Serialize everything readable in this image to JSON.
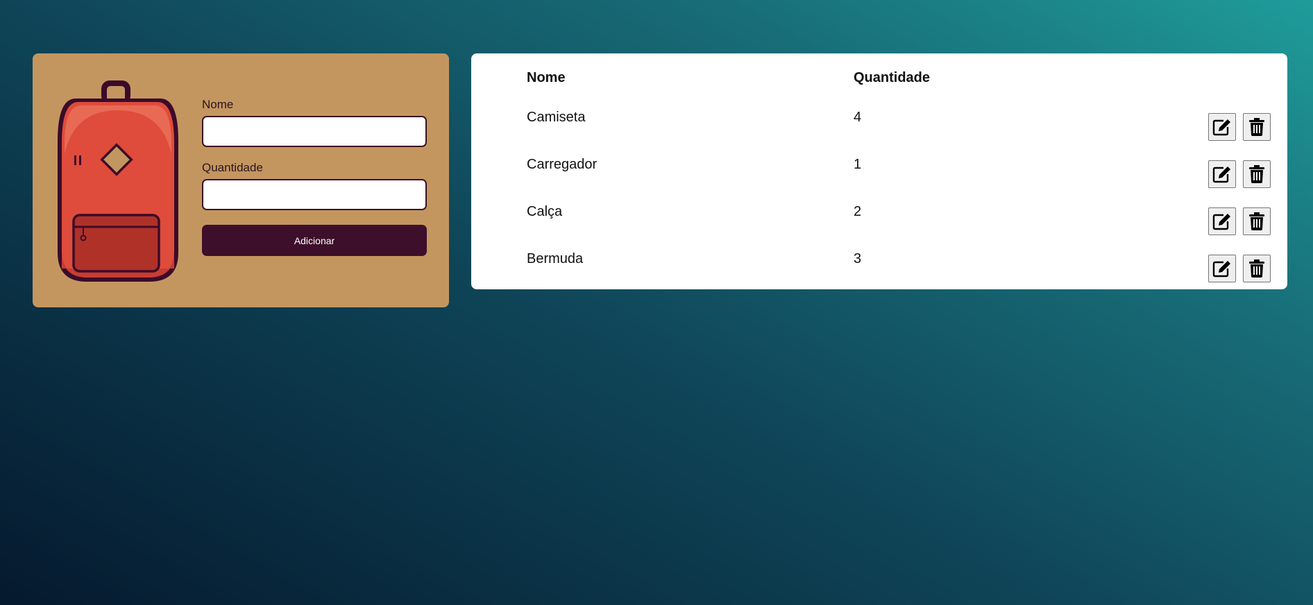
{
  "form": {
    "name_label": "Nome",
    "name_value": "",
    "quantity_label": "Quantidade",
    "quantity_value": "",
    "add_label": "Adicionar"
  },
  "table": {
    "headers": [
      "Nome",
      "Quantidade"
    ],
    "rows": [
      {
        "name": "Camiseta",
        "quantity": "4"
      },
      {
        "name": "Carregador",
        "quantity": "1"
      },
      {
        "name": "Calça",
        "quantity": "2"
      },
      {
        "name": "Bermuda",
        "quantity": "3"
      }
    ]
  },
  "icons": {
    "illustration": "backpack-icon",
    "edit": "edit-icon",
    "delete": "trash-icon"
  },
  "colors": {
    "form_card": "#c4965f",
    "button": "#3d0f2a",
    "backpack_body": "#df4c3b",
    "backpack_outline": "#3a0c2a"
  }
}
